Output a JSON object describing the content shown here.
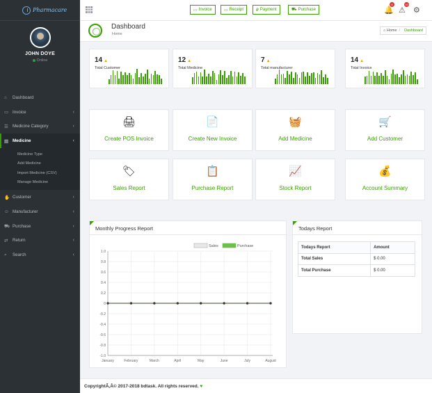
{
  "app": {
    "logo_text": "Pharmacare",
    "copyright": "CopyrightÃ‚Â© 2017-2018 bdtask. All rights reserved.",
    "heart": "♥"
  },
  "sidebar": {
    "user_name": "JOHN DOYE",
    "user_status": "Online",
    "items": [
      {
        "label": "Dashboard",
        "icon": "home-icon",
        "glyph": "⌂",
        "has_chevron": false
      },
      {
        "label": "Invoice",
        "icon": "invoice-icon",
        "glyph": "▭",
        "has_chevron": true
      },
      {
        "label": "Medicine Category",
        "icon": "list-icon",
        "glyph": "☰",
        "has_chevron": true
      },
      {
        "label": "Medicine",
        "icon": "medicine-icon",
        "glyph": "▤",
        "has_chevron": true,
        "active": true
      },
      {
        "label": "Customer",
        "icon": "handshake-icon",
        "glyph": "✋",
        "has_chevron": true
      },
      {
        "label": "Manufacturer",
        "icon": "user-icon",
        "glyph": "☺",
        "has_chevron": true
      },
      {
        "label": "Purchase",
        "icon": "cart-icon",
        "glyph": "⛟",
        "has_chevron": true
      },
      {
        "label": "Return",
        "icon": "return-icon",
        "glyph": "⇄",
        "has_chevron": true
      },
      {
        "label": "Search",
        "icon": "search-icon",
        "glyph": "⌕",
        "has_chevron": true
      }
    ],
    "subitems": [
      "Medicine Type",
      "Add Medicine",
      "Import Medicine (CSV)",
      "Manage Medicine"
    ]
  },
  "topbar": {
    "buttons": [
      {
        "label": "Invoice",
        "icon": "invoice-icon",
        "glyph": "▭"
      },
      {
        "label": "Receipt",
        "icon": "receipt-icon",
        "glyph": "▭"
      },
      {
        "label": "Payment",
        "icon": "payment-icon",
        "glyph": "₽"
      },
      {
        "label": "Purchase",
        "icon": "cart-icon",
        "glyph": "⛟"
      }
    ],
    "notification_count": "6",
    "alert_count": "10"
  },
  "page": {
    "title": "Dashboard",
    "subtitle": "Home",
    "breadcrumb_home": "Home",
    "breadcrumb_sep": "/",
    "breadcrumb_current": "Dashboard"
  },
  "stats": [
    {
      "value": "14",
      "label": "Total Customer"
    },
    {
      "value": "12",
      "label": "Total Medicine"
    },
    {
      "value": "7",
      "label": "Total manufacturer"
    },
    {
      "value": "14",
      "label": "Total Invoice"
    }
  ],
  "actions": [
    {
      "label": "Create POS Invoice",
      "icon": "pos-icon",
      "glyph": "🖨"
    },
    {
      "label": "Create New Invoice",
      "icon": "new-invoice-icon",
      "glyph": "📄"
    },
    {
      "label": "Add Medicine",
      "icon": "basket-icon",
      "glyph": "🧺"
    },
    {
      "label": "Add Customer",
      "icon": "customer-cart-icon",
      "glyph": "🛒"
    },
    {
      "label": "Sales Report",
      "icon": "tag-icon",
      "glyph": "🏷"
    },
    {
      "label": "Purchase Report",
      "icon": "checklist-icon",
      "glyph": "📋"
    },
    {
      "label": "Stock Report",
      "icon": "growth-icon",
      "glyph": "📈"
    },
    {
      "label": "Account Summary",
      "icon": "coins-icon",
      "glyph": "💰"
    }
  ],
  "monthly_panel": {
    "title": "Monthly Progress Report"
  },
  "todays_panel": {
    "title": "Todays Report",
    "headers": [
      "Todays Report",
      "Amount"
    ],
    "rows": [
      {
        "label": "Total Sales",
        "amount": "$ 0.00"
      },
      {
        "label": "Total Purchase",
        "amount": "$ 0.00"
      }
    ]
  },
  "colors": {
    "accent": "#37a000",
    "sidebar_bg": "#2c3136",
    "badge": "#e03131"
  },
  "chart_data": {
    "type": "line",
    "title": "",
    "xlabel": "",
    "ylabel": "",
    "categories": [
      "January",
      "February",
      "March",
      "April",
      "May",
      "June",
      "July",
      "August"
    ],
    "ylim": [
      -1.0,
      1.0
    ],
    "yticks": [
      "1.0",
      "0.8",
      "0.6",
      "0.4",
      "0.2",
      "0",
      "-0.2",
      "-0.4",
      "-0.6",
      "-0.8",
      "-1.0"
    ],
    "series": [
      {
        "name": "Sales",
        "values": [
          0,
          0,
          0,
          0,
          0,
          0,
          0,
          0
        ],
        "color": "#e8e8e8"
      },
      {
        "name": "Purchase",
        "values": [
          0,
          0,
          0,
          0,
          0,
          0,
          0,
          0
        ],
        "color": "#6cbf4a"
      }
    ],
    "legend": "top",
    "grid": true
  }
}
